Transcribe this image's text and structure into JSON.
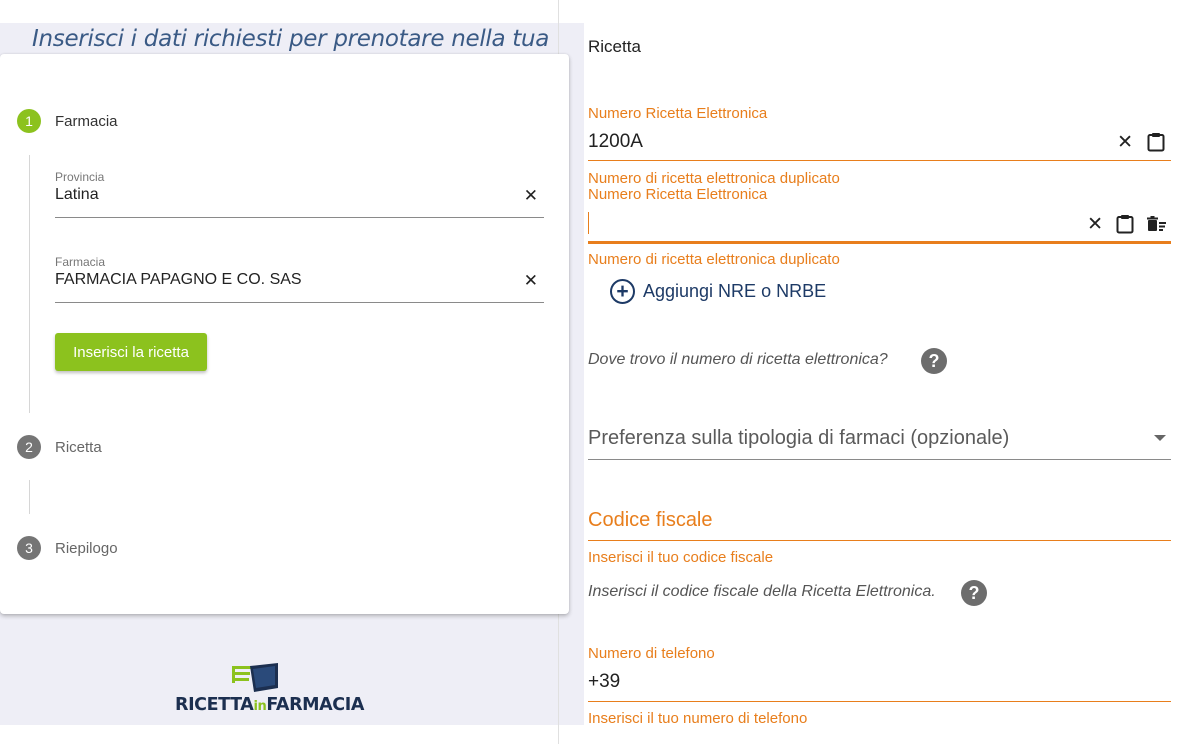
{
  "intro_text": "Inserisci i dati richiesti per prenotare nella tua",
  "stepper": {
    "steps": [
      {
        "number": "1",
        "label": "Farmacia"
      },
      {
        "number": "2",
        "label": "Ricetta"
      },
      {
        "number": "3",
        "label": "Riepilogo"
      }
    ]
  },
  "farmacia_form": {
    "provincia": {
      "label": "Provincia",
      "value": "Latina"
    },
    "farmacia": {
      "label": "Farmacia",
      "value": "FARMACIA PAPAGNO E CO. SAS"
    },
    "submit_label": "Inserisci la ricetta"
  },
  "logo": {
    "part1": "RICETTA",
    "part2": "in",
    "part3": "FARMACIA"
  },
  "ricetta": {
    "title": "Ricetta",
    "nre_1": {
      "label": "Numero Ricetta Elettronica",
      "value": "1200A",
      "error": "Numero di ricetta elettronica duplicato"
    },
    "nre_2": {
      "label": "Numero Ricetta Elettronica",
      "value": "",
      "error": "Numero di ricetta elettronica duplicato"
    },
    "add_label": "Aggiungi NRE o NRBE",
    "help_nre": "Dove trovo il numero di ricetta elettronica?",
    "preference_placeholder": "Preferenza sulla tipologia di farmaci (opzionale)",
    "codice_fiscale": {
      "placeholder": "Codice fiscale",
      "hint": "Inserisci il tuo codice fiscale",
      "help": "Inserisci il codice fiscale della Ricetta Elettronica."
    },
    "telefono": {
      "label": "Numero di telefono",
      "value": "+39",
      "hint": "Inserisci il tuo numero di telefono"
    }
  },
  "icons": {
    "clear": "close-icon",
    "paste": "clipboard-icon",
    "delete": "delete-sweep-icon",
    "help": "help-circle-icon",
    "add": "plus-circle-icon",
    "dropdown": "caret-down-icon"
  },
  "colors": {
    "accent_green": "#8cc21e",
    "accent_orange": "#e87e1c",
    "navy": "#1d3a66"
  }
}
